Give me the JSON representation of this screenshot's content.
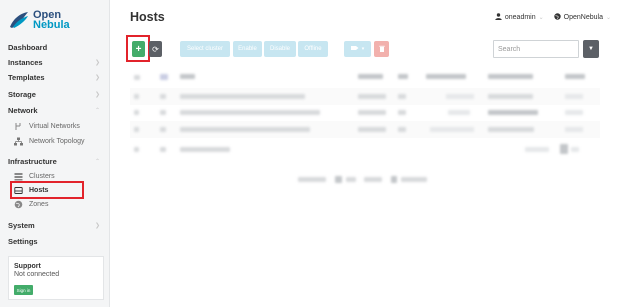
{
  "app": {
    "logo_line1": "Open",
    "logo_line2": "Nebula"
  },
  "header": {
    "title": "Hosts",
    "user": "oneadmin",
    "zone": "OpenNebula"
  },
  "toolbar": {
    "add": "+",
    "refresh": "⟳",
    "select_cluster": "Select cluster",
    "enable": "Enable",
    "disable": "Disable",
    "offline": "Offline",
    "search_placeholder": "Search"
  },
  "sidebar": {
    "dashboard": "Dashboard",
    "instances": "Instances",
    "templates": "Templates",
    "storage": "Storage",
    "network": "Network",
    "virtual_networks": "Virtual Networks",
    "network_topology": "Network Topology",
    "infrastructure": "Infrastructure",
    "clusters": "Clusters",
    "hosts": "Hosts",
    "zones": "Zones",
    "system": "System",
    "settings": "Settings"
  },
  "support": {
    "title": "Support",
    "status": "Not connected",
    "signin": "Sign in"
  },
  "colors": {
    "accent_green": "#43ac6a",
    "dark_button": "#5c6066",
    "highlight_red": "#e2232b",
    "disabled_blue": "#c7e6f1",
    "brand_blue": "#0098c3"
  }
}
